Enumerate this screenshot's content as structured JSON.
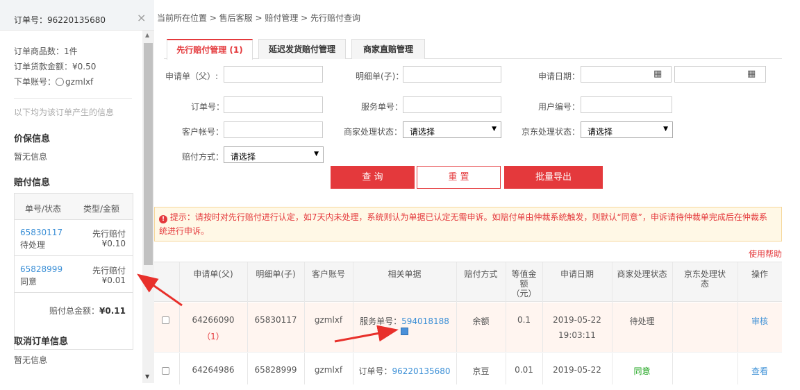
{
  "sidebar": {
    "title": "订单号：96220135680",
    "close": "×",
    "goods_count": "订单商品数：1件",
    "goods_amount": "订单货款金额：¥0.50",
    "account_prefix": "下单账号：",
    "account": "gzmlxf",
    "info_hint": "以下均为该订单产生的信息",
    "insured_title": "价保信息",
    "insured_value": "暂无信息",
    "pay_title": "赔付信息",
    "pay_table": {
      "col1": "单号/状态",
      "col2": "类型/金额",
      "rows": [
        {
          "no": "65830117",
          "status": "待处理",
          "type": "先行赔付",
          "amount": "¥0.10"
        },
        {
          "no": "65828999",
          "status": "同意",
          "type": "先行赔付",
          "amount": "¥0.01"
        }
      ],
      "total_label": "赔付总金额：",
      "total_value": "¥0.11"
    },
    "cancel_title": "取消订单信息",
    "cancel_value": "暂无信息"
  },
  "breadcrumb": "当前所在位置 > 售后客服 > 赔付管理 > 先行赔付查询",
  "tabs": [
    "先行赔付管理 (1)",
    "延迟发货赔付管理",
    "商家直赔管理"
  ],
  "form": {
    "apply_no_label": "申请单（父）:",
    "detail_no_label": "明细单(子)：",
    "apply_date_label": "申请日期：",
    "order_no_label": "订单号：",
    "service_no_label": "服务单号：",
    "user_no_label": "用户编号：",
    "customer_label": "客户帐号：",
    "merchant_status_label": "商家处理状态：",
    "merchant_status_value": "请选择",
    "jd_status_label": "京东处理状态：",
    "jd_status_value": "请选择",
    "pay_method_label": "赔付方式：",
    "pay_method_value": "请选择"
  },
  "buttons": {
    "query": "查 询",
    "reset": "重 置",
    "export": "批量导出"
  },
  "notice": {
    "icon": "!",
    "line1": "提示：请按时对先行赔付进行认定，如7天内未处理，系统则认为单据已认定无需申诉。如赔付单由仲裁系统触发，则默认“同意”，申诉请待仲裁单完成后在仲裁系",
    "line2": "统进行申诉。"
  },
  "help": "使用帮助",
  "table": {
    "headers": {
      "apply": "申请单(父)",
      "detail": "明细单(子)",
      "account": "客户账号",
      "related": "相关单据",
      "method": "赔付方式",
      "amount_1": "等值金",
      "amount_2": "额",
      "amount_3": "（元）",
      "date": "申请日期",
      "merchant": "商家处理状态",
      "jd_1": "京东处理状",
      "jd_2": "态",
      "op": "操作"
    },
    "rows": [
      {
        "apply": "64266090",
        "apply_sub": "（1）",
        "detail": "65830117",
        "account": "gzmlxf",
        "related_prefix": "服务单号：",
        "related_no": "594018188",
        "method": "余额",
        "amount": "0.1",
        "date": "2019-05-22",
        "time": "19:03:11",
        "merchant": "待处理",
        "jd": "",
        "op": "审核"
      },
      {
        "apply": "64264986",
        "detail": "65828999",
        "account": "gzmlxf",
        "related_prefix": "订单号：",
        "related_no": "96220135680",
        "method": "京豆",
        "amount": "0.01",
        "date": "2019-05-22",
        "merchant": "同意",
        "jd": "",
        "op": "查看"
      }
    ]
  },
  "colors": {
    "accent": "#e4393c",
    "link": "#3b8fd6",
    "agree": "#1aa31a",
    "annotation_arrow": "#e8302b"
  }
}
